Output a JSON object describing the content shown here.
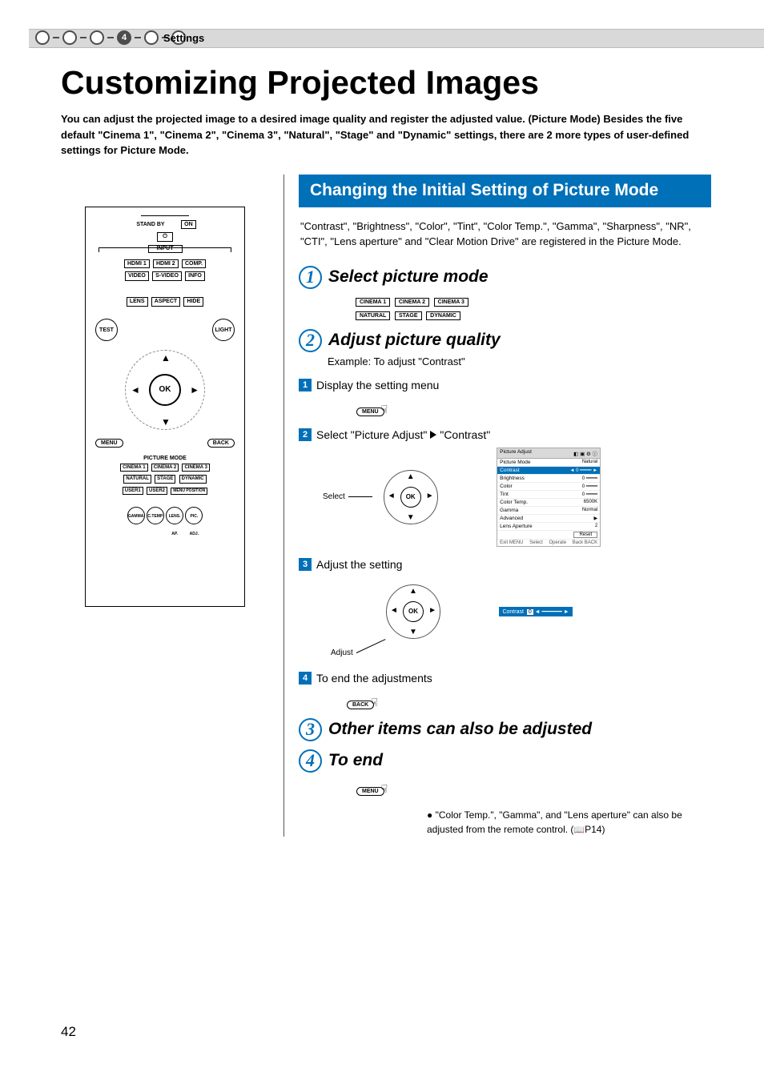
{
  "breadcrumb": {
    "active_num": "4",
    "label": "Settings"
  },
  "h1": "Customizing Projected Images",
  "intro_pre": "You can adjust the projected image to a desired image quality and register the adjusted value. (Picture Mode) Besides the five default ",
  "intro_modes": [
    "Cinema 1",
    "Cinema 2",
    "Cinema 3",
    "Natural",
    "Stage",
    "Dynamic"
  ],
  "intro_post": " settings, there are 2 more types of user-defined settings for Picture Mode.",
  "remote": {
    "standby": "STAND BY",
    "on": "ON",
    "input": "INPUT",
    "inputs_row1": [
      "HDMI 1",
      "HDMI 2",
      "COMP."
    ],
    "inputs_row2": [
      "VIDEO",
      "S-VIDEO",
      "INFO"
    ],
    "row3": [
      "LENS",
      "ASPECT",
      "HIDE"
    ],
    "test": "TEST",
    "light": "LIGHT",
    "ok": "OK",
    "menu": "MENU",
    "back": "BACK",
    "picture_mode": "PICTURE MODE",
    "pm_row1": [
      "CINEMA 1",
      "CINEMA 2",
      "CINEMA 3"
    ],
    "pm_row2": [
      "NATURAL",
      "STAGE",
      "DYNAMIC"
    ],
    "pm_row3": [
      "USER1",
      "USER2",
      "MENU POSITION"
    ],
    "round_row": [
      "GAMMA",
      "C.TEMP",
      "LENS. AP.",
      "PIC. ADJ."
    ]
  },
  "section": {
    "heading": "Changing the Initial Setting of Picture Mode",
    "desc": "\"Contrast\", \"Brightness\", \"Color\", \"Tint\", \"Color Temp.\", \"Gamma\", \"Sharpness\", \"NR\", \"CTI\", \"Lens aperture\" and \"Clear Motion Drive\" are registered in the Picture Mode.",
    "steps": [
      {
        "n": "1",
        "title": "Select picture mode",
        "modes_row1": [
          "CINEMA 1",
          "CINEMA 2",
          "CINEMA 3"
        ],
        "modes_row2": [
          "NATURAL",
          "STAGE",
          "DYNAMIC"
        ]
      },
      {
        "n": "2",
        "title": "Adjust picture quality",
        "example": "Example: To adjust \"Contrast\"",
        "sub": [
          {
            "n": "1",
            "t": "Display the setting menu"
          },
          {
            "n": "2",
            "t_pre": "Select \"Picture Adjust\" ",
            "t_post": " \"Contrast\""
          },
          {
            "n": "3",
            "t": "Adjust the setting"
          },
          {
            "n": "4",
            "t": "To end the adjustments"
          }
        ],
        "menu_btn": "MENU",
        "back_btn": "BACK",
        "select_label": "Select",
        "adjust_label": "Adjust",
        "ok": "OK"
      },
      {
        "n": "3",
        "title": "Other items can also be adjusted"
      },
      {
        "n": "4",
        "title": "To end",
        "menu_btn": "MENU"
      }
    ],
    "note": "\"Color Temp.\", \"Gamma\", and \"Lens aperture\" can also be adjusted from the remote control. (",
    "note_ref": "P14)"
  },
  "osd": {
    "tab": "Picture Adjust",
    "rows": [
      {
        "k": "Picture Mode",
        "v": "Natural"
      },
      {
        "k": "Contrast",
        "v": "0",
        "hl": true,
        "slider": true
      },
      {
        "k": "Brightness",
        "v": "0",
        "slider": true
      },
      {
        "k": "Color",
        "v": "0",
        "slider": true
      },
      {
        "k": "Tint",
        "v": "0",
        "slider": true
      },
      {
        "k": "Color Temp.",
        "v": "6500K"
      },
      {
        "k": "Gamma",
        "v": "Normal"
      },
      {
        "k": "Advanced",
        "v": "▶"
      },
      {
        "k": "Lens Aperture",
        "v": "2"
      },
      {
        "k": "",
        "v": "Reset"
      }
    ],
    "bot_l": "Exit MENU",
    "bot_c": "Select",
    "bot_op": "Operate",
    "bot_r": "Back BACK"
  },
  "contrast_bar": {
    "label": "Contrast",
    "val": "0"
  },
  "page": "42"
}
